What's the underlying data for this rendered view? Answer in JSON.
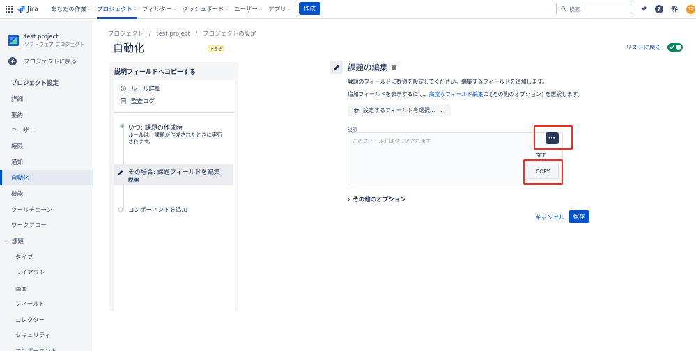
{
  "topnav": {
    "logo": "Jira",
    "items": [
      {
        "label": "あなたの作業"
      },
      {
        "label": "プロジェクト"
      },
      {
        "label": "フィルター"
      },
      {
        "label": "ダッシュボード"
      },
      {
        "label": "ユーザー"
      },
      {
        "label": "アプリ"
      }
    ],
    "create_label": "作成",
    "search_placeholder": "検索",
    "avatar_initials": "YS"
  },
  "sidebar": {
    "project_name": "test project",
    "project_type": "ソフトウェア プロジェクト",
    "back_label": "プロジェクトに戻る",
    "settings_heading": "プロジェクト設定",
    "items": [
      {
        "label": "詳細"
      },
      {
        "label": "要約"
      },
      {
        "label": "ユーザー"
      },
      {
        "label": "権限"
      },
      {
        "label": "通知"
      },
      {
        "label": "自動化"
      },
      {
        "label": "機能"
      },
      {
        "label": "ツールチェーン"
      },
      {
        "label": "ワークフロー"
      }
    ],
    "issues_label": "課題",
    "issue_items": [
      {
        "label": "タイプ"
      },
      {
        "label": "レイアウト"
      },
      {
        "label": "画面"
      },
      {
        "label": "フィールド"
      },
      {
        "label": "コレクター"
      },
      {
        "label": "セキュリティ"
      },
      {
        "label": "コンポーネント"
      }
    ]
  },
  "main": {
    "breadcrumb": [
      "プロジェクト",
      "test project",
      "プロジェクトの設定"
    ],
    "title": "自動化",
    "draft_badge": "下書き",
    "back_to_list": "リストに戻る",
    "rule_panel": {
      "title": "説明フィールドへコピーする",
      "rule_details": "ルール詳細",
      "audit_log": "監査ログ",
      "trigger_title": "いつ: 課題の作成時",
      "trigger_desc_1": "ルールは、課題が作成されたときに実行",
      "trigger_desc_2": "されます。",
      "action_title": "その場合: 課題フィールドを編集",
      "action_sub": "説明",
      "add_component": "コンポーネントを追加"
    },
    "editor": {
      "title": "課題の編集",
      "desc1": "課題のフィールドに数値を設定してください。編集するフィールドを追加します。",
      "desc2_prefix": "追加フィールドを表示するには、",
      "desc2_link": "高度なフィールド編集",
      "desc2_suffix": "の [その他のオプション] を選択します。",
      "field_select": "設定するフィールドを選択...",
      "field_label": "説明",
      "field_placeholder": "このフィールドはクリアされます",
      "set_label": "SET",
      "copy_label": "COPY",
      "more_options": "その他のオプション",
      "cancel": "キャンセル",
      "save": "保存"
    }
  },
  "colors": {
    "brand": "#0052cc",
    "toggle_on": "#00875a",
    "annotation": "#ff2a1a"
  }
}
